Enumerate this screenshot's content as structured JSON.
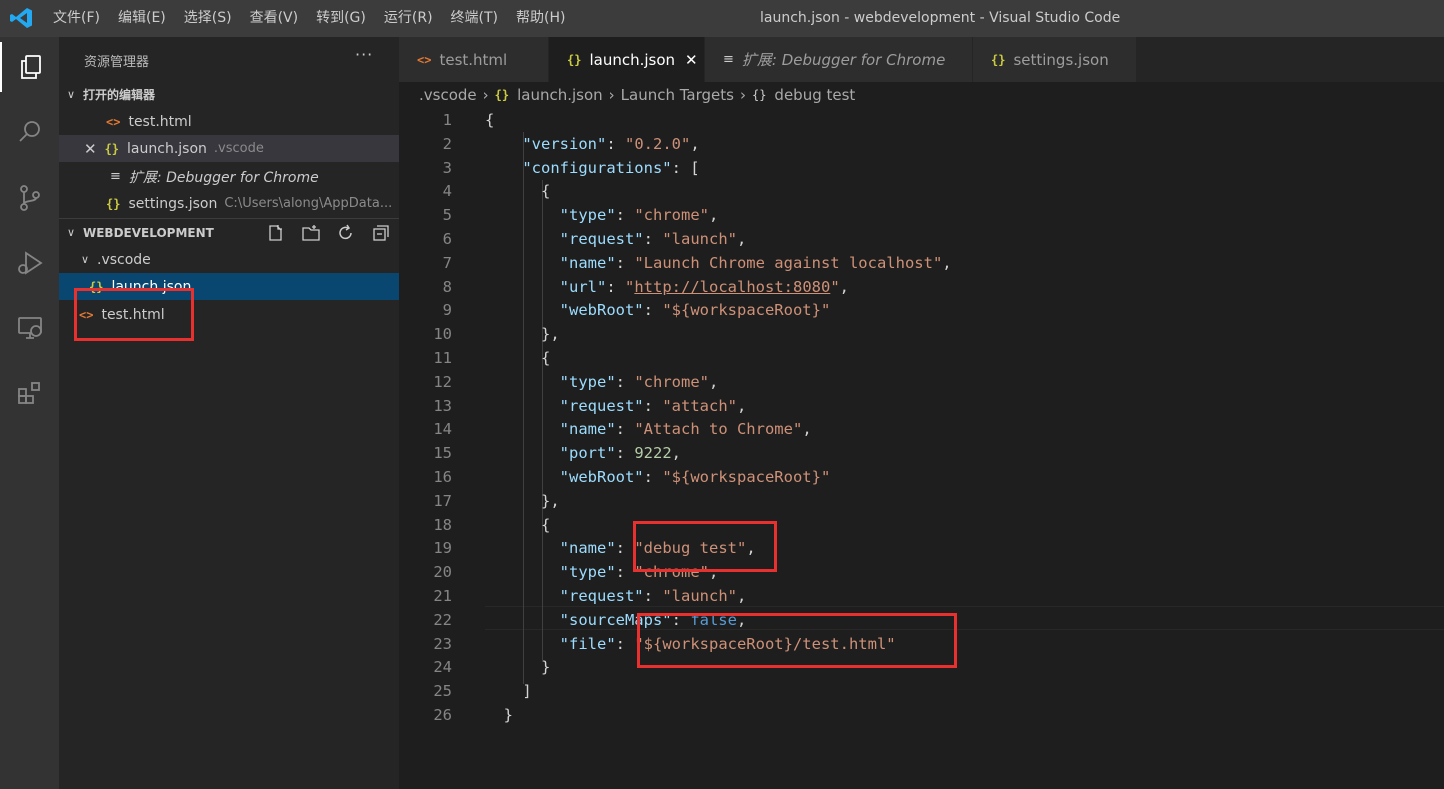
{
  "titlebar": {
    "menu": [
      "文件(F)",
      "编辑(E)",
      "选择(S)",
      "查看(V)",
      "转到(G)",
      "运行(R)",
      "终端(T)",
      "帮助(H)"
    ],
    "window_title": "launch.json - webdevelopment - Visual Studio Code"
  },
  "sidebar": {
    "header": "资源管理器",
    "more": "···",
    "open_editors": {
      "title": "打开的编辑器",
      "items": [
        {
          "name": "test.html",
          "detail": ""
        },
        {
          "name": "launch.json",
          "detail": ".vscode"
        },
        {
          "name": "扩展: Debugger for Chrome",
          "detail": ""
        },
        {
          "name": "settings.json",
          "detail": "C:\\Users\\along\\AppData..."
        }
      ]
    },
    "workspace": {
      "title": "WEBDEVELOPMENT",
      "folder": ".vscode",
      "files": [
        "launch.json",
        "test.html"
      ]
    }
  },
  "tabs": [
    {
      "label": "test.html",
      "icon": "html-icon"
    },
    {
      "label": "launch.json",
      "icon": "json-icon",
      "active": true
    },
    {
      "label": "扩展: Debugger for Chrome",
      "icon": "doc-icon"
    },
    {
      "label": "settings.json",
      "icon": "json-icon"
    }
  ],
  "breadcrumb": [
    ".vscode",
    "launch.json",
    "Launch Targets",
    "debug test"
  ],
  "editor": {
    "lines": [
      {
        "n": "1",
        "t": [
          [
            "p",
            "{"
          ]
        ]
      },
      {
        "n": "2",
        "t": [
          [
            "p",
            "    "
          ],
          [
            "k",
            "\"version\""
          ],
          [
            "p",
            ": "
          ],
          [
            "s",
            "\"0.2.0\""
          ],
          [
            "p",
            ","
          ]
        ]
      },
      {
        "n": "3",
        "t": [
          [
            "p",
            "    "
          ],
          [
            "k",
            "\"configurations\""
          ],
          [
            "p",
            ": ["
          ]
        ]
      },
      {
        "n": "4",
        "t": [
          [
            "p",
            "      {"
          ]
        ]
      },
      {
        "n": "5",
        "t": [
          [
            "p",
            "        "
          ],
          [
            "k",
            "\"type\""
          ],
          [
            "p",
            ": "
          ],
          [
            "s",
            "\"chrome\""
          ],
          [
            "p",
            ","
          ]
        ]
      },
      {
        "n": "6",
        "t": [
          [
            "p",
            "        "
          ],
          [
            "k",
            "\"request\""
          ],
          [
            "p",
            ": "
          ],
          [
            "s",
            "\"launch\""
          ],
          [
            "p",
            ","
          ]
        ]
      },
      {
        "n": "7",
        "t": [
          [
            "p",
            "        "
          ],
          [
            "k",
            "\"name\""
          ],
          [
            "p",
            ": "
          ],
          [
            "s",
            "\"Launch Chrome against localhost\""
          ],
          [
            "p",
            ","
          ]
        ]
      },
      {
        "n": "8",
        "t": [
          [
            "p",
            "        "
          ],
          [
            "k",
            "\"url\""
          ],
          [
            "p",
            ": "
          ],
          [
            "s",
            "\""
          ],
          [
            "u",
            "http://localhost:8080"
          ],
          [
            "s",
            "\""
          ],
          [
            "p",
            ","
          ]
        ]
      },
      {
        "n": "9",
        "t": [
          [
            "p",
            "        "
          ],
          [
            "k",
            "\"webRoot\""
          ],
          [
            "p",
            ": "
          ],
          [
            "s",
            "\"${workspaceRoot}\""
          ]
        ]
      },
      {
        "n": "10",
        "t": [
          [
            "p",
            "      },"
          ]
        ]
      },
      {
        "n": "11",
        "t": [
          [
            "p",
            "      {"
          ]
        ]
      },
      {
        "n": "12",
        "t": [
          [
            "p",
            "        "
          ],
          [
            "k",
            "\"type\""
          ],
          [
            "p",
            ": "
          ],
          [
            "s",
            "\"chrome\""
          ],
          [
            "p",
            ","
          ]
        ]
      },
      {
        "n": "13",
        "t": [
          [
            "p",
            "        "
          ],
          [
            "k",
            "\"request\""
          ],
          [
            "p",
            ": "
          ],
          [
            "s",
            "\"attach\""
          ],
          [
            "p",
            ","
          ]
        ]
      },
      {
        "n": "14",
        "t": [
          [
            "p",
            "        "
          ],
          [
            "k",
            "\"name\""
          ],
          [
            "p",
            ": "
          ],
          [
            "s",
            "\"Attach to Chrome\""
          ],
          [
            "p",
            ","
          ]
        ]
      },
      {
        "n": "15",
        "t": [
          [
            "p",
            "        "
          ],
          [
            "k",
            "\"port\""
          ],
          [
            "p",
            ": "
          ],
          [
            "n",
            "9222"
          ],
          [
            "p",
            ","
          ]
        ]
      },
      {
        "n": "16",
        "t": [
          [
            "p",
            "        "
          ],
          [
            "k",
            "\"webRoot\""
          ],
          [
            "p",
            ": "
          ],
          [
            "s",
            "\"${workspaceRoot}\""
          ]
        ]
      },
      {
        "n": "17",
        "t": [
          [
            "p",
            "      },"
          ]
        ]
      },
      {
        "n": "18",
        "t": [
          [
            "p",
            "      {"
          ]
        ]
      },
      {
        "n": "19",
        "t": [
          [
            "p",
            "        "
          ],
          [
            "k",
            "\"name\""
          ],
          [
            "p",
            ": "
          ],
          [
            "s",
            "\"debug test\""
          ],
          [
            "p",
            ","
          ]
        ]
      },
      {
        "n": "20",
        "t": [
          [
            "p",
            "        "
          ],
          [
            "k",
            "\"type\""
          ],
          [
            "p",
            ": "
          ],
          [
            "s",
            "\"chrome\""
          ],
          [
            "p",
            ","
          ]
        ]
      },
      {
        "n": "21",
        "t": [
          [
            "p",
            "        "
          ],
          [
            "k",
            "\"request\""
          ],
          [
            "p",
            ": "
          ],
          [
            "s",
            "\"launch\""
          ],
          [
            "p",
            ","
          ]
        ]
      },
      {
        "n": "22",
        "t": [
          [
            "p",
            "        "
          ],
          [
            "k",
            "\"sourceMaps\""
          ],
          [
            "p",
            ": "
          ],
          [
            "b",
            "false"
          ],
          [
            "p",
            ","
          ]
        ]
      },
      {
        "n": "23",
        "t": [
          [
            "p",
            "        "
          ],
          [
            "k",
            "\"file\""
          ],
          [
            "p",
            ": "
          ],
          [
            "s",
            "\"${workspaceRoot}/test.html\""
          ]
        ]
      },
      {
        "n": "24",
        "t": [
          [
            "p",
            "      }"
          ]
        ]
      },
      {
        "n": "25",
        "t": [
          [
            "p",
            "    ]"
          ]
        ]
      },
      {
        "n": "26",
        "t": [
          [
            "p",
            "  }"
          ]
        ]
      }
    ]
  },
  "colors": {
    "highlight": "#e8302f",
    "selection": "#094771",
    "titlebar": "#3c3c3c",
    "editor": "#1e1e1e"
  }
}
